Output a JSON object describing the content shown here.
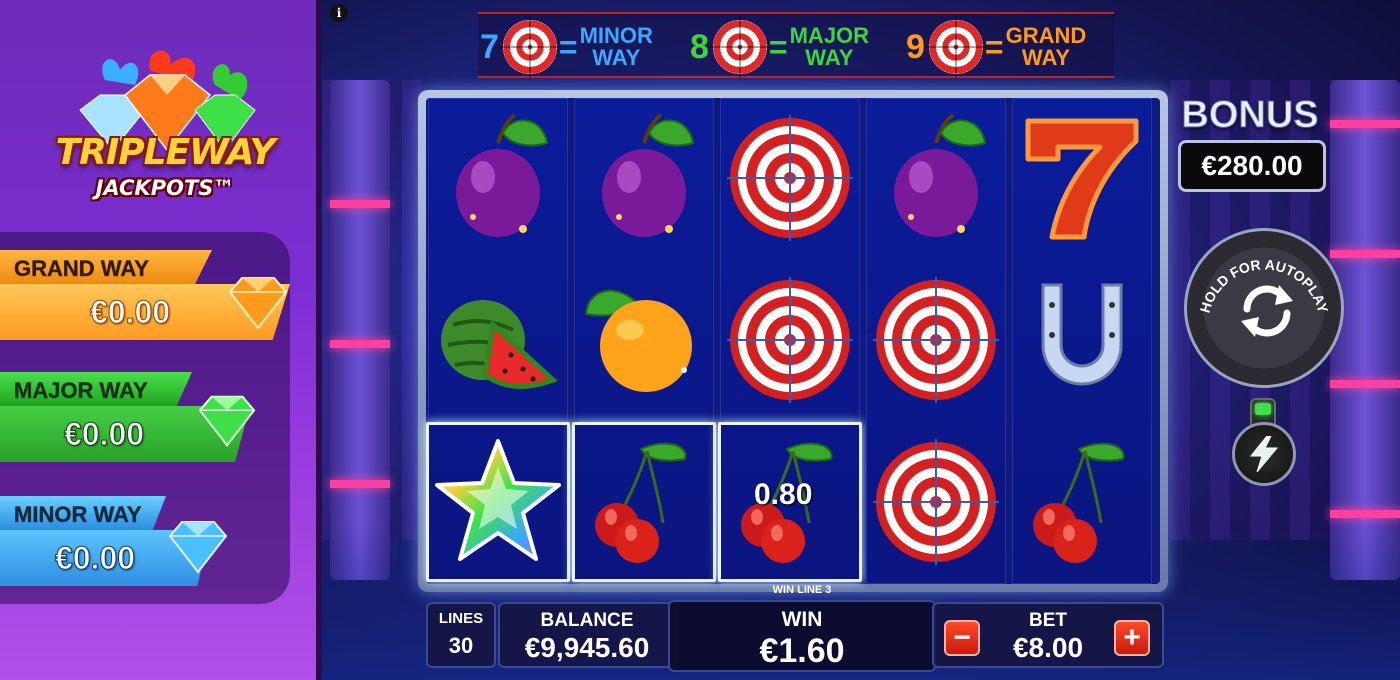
{
  "info_button": "i",
  "logo": {
    "title": "TRIPLEWAY",
    "subtitle": "JACKPOTS™"
  },
  "jackpots": [
    {
      "label": "GRAND WAY",
      "value": "€0.00"
    },
    {
      "label": "MAJOR WAY",
      "value": "€0.00"
    },
    {
      "label": "MINOR WAY",
      "value": "€0.00"
    }
  ],
  "banner": [
    {
      "count": "7",
      "eq": "=",
      "label_line1": "MINOR",
      "label_line2": "WAY",
      "color": "#3aa8ff"
    },
    {
      "count": "8",
      "eq": "=",
      "label_line1": "MAJOR",
      "label_line2": "WAY",
      "color": "#3ad83a"
    },
    {
      "count": "9",
      "eq": "=",
      "label_line1": "GRAND",
      "label_line2": "WAY",
      "color": "#ff9a1a"
    }
  ],
  "reels": [
    [
      "plum",
      "watermelon",
      "star"
    ],
    [
      "plum",
      "orange",
      "cherries"
    ],
    [
      "target",
      "target",
      "cherries"
    ],
    [
      "plum",
      "target",
      "target"
    ],
    [
      "seven",
      "horseshoe",
      "cherries"
    ]
  ],
  "win_display": {
    "amount": "0.80"
  },
  "bonus": {
    "title": "BONUS",
    "value": "€280.00"
  },
  "autoplay": {
    "label": "HOLD FOR AUTOPLAY",
    "icon": "refresh-icon"
  },
  "turbo": {
    "icon": "lightning-icon"
  },
  "bottom_bar": {
    "lines_label": "LINES",
    "lines_value": "30",
    "balance_label": "BALANCE",
    "balance_value": "€9,945.60",
    "win_line_text": "WIN LINE 3",
    "win_label": "WIN",
    "win_value": "€1.60",
    "bet_label": "BET",
    "bet_value": "€8.00",
    "bet_minus": "−",
    "bet_plus": "+"
  }
}
